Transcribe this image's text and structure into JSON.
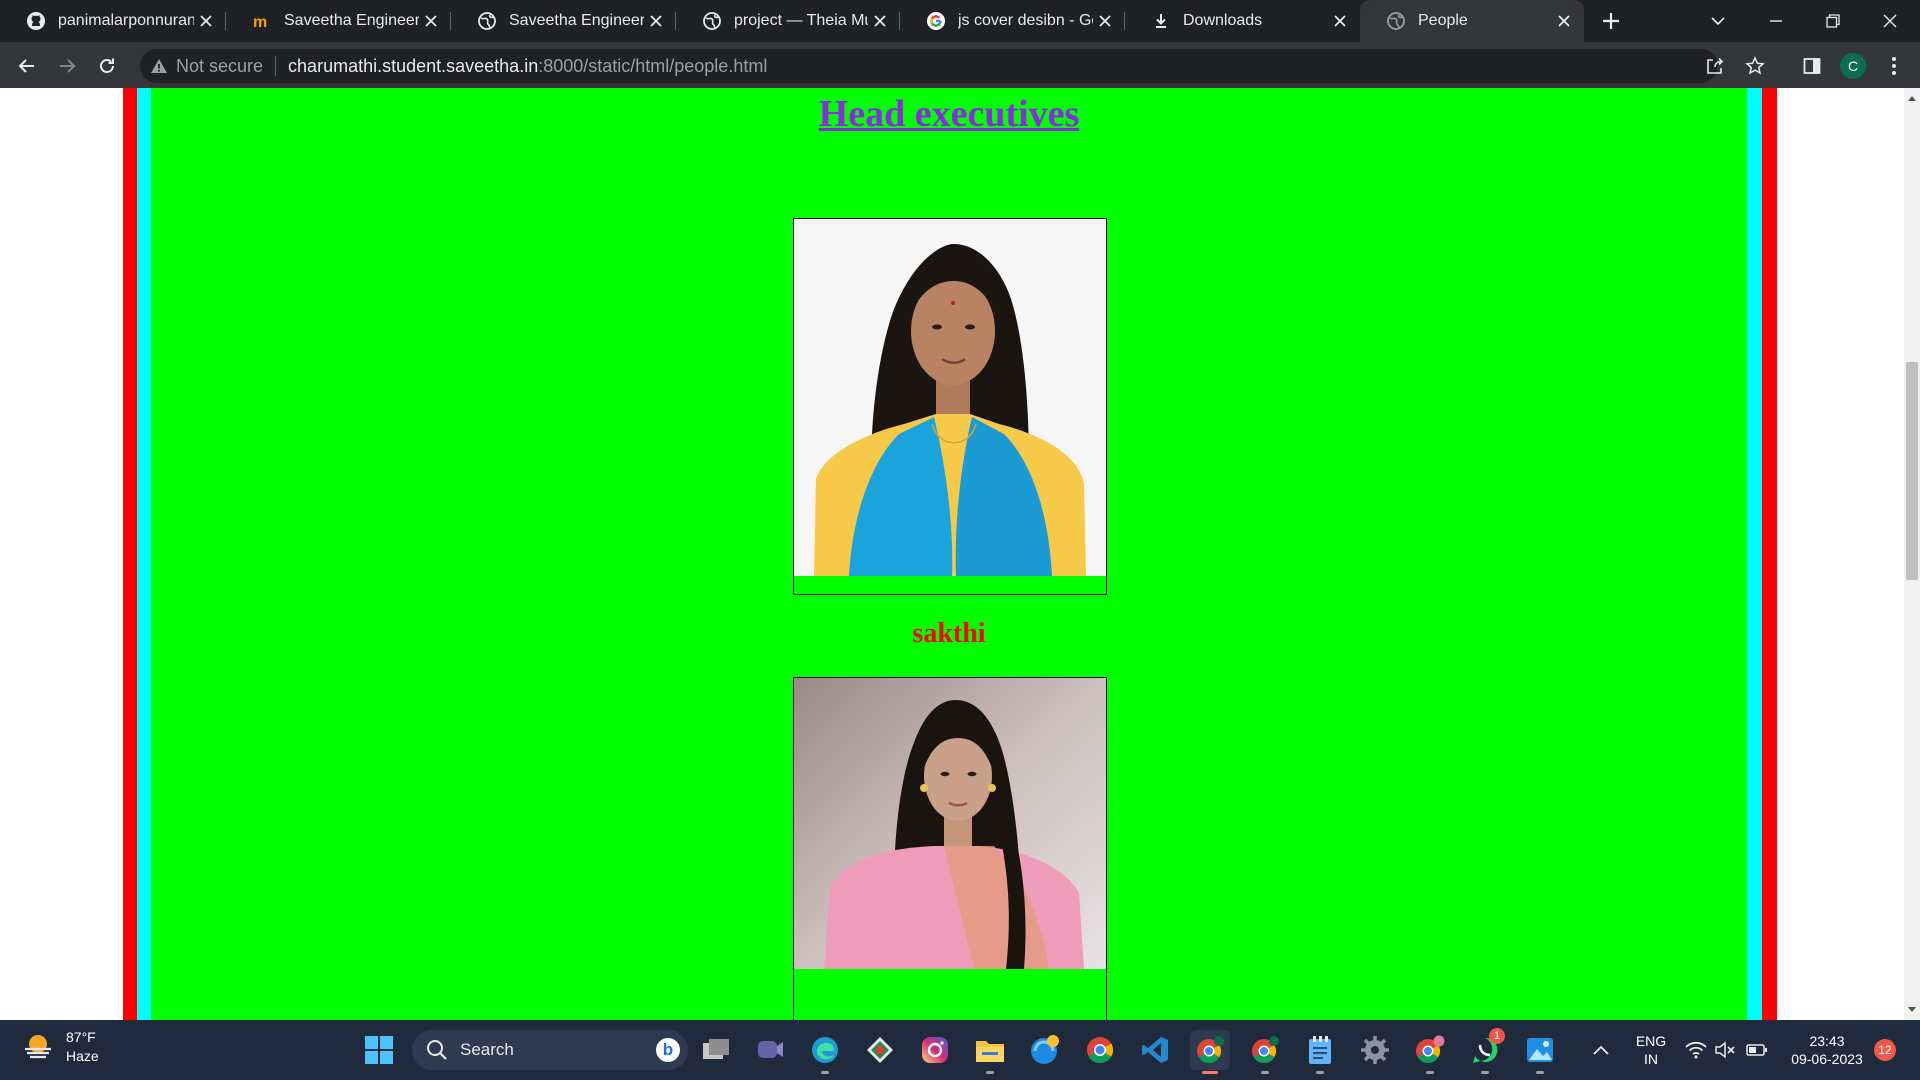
{
  "browser": {
    "tabs": [
      {
        "title": "panimalarponnurangam",
        "icon": "github-icon"
      },
      {
        "title": "Saveetha Engineering",
        "icon": "saveetha-m-icon"
      },
      {
        "title": "Saveetha Engineering",
        "icon": "globe-icon"
      },
      {
        "title": "project — Theia Multi",
        "icon": "globe-icon"
      },
      {
        "title": "js cover desibn - Goo",
        "icon": "google-icon"
      },
      {
        "title": "Downloads",
        "icon": "download-icon"
      },
      {
        "title": "People",
        "icon": "globe-icon",
        "active": true
      }
    ],
    "address": {
      "security_label": "Not secure",
      "url_host": "charumathi.student.saveetha.in",
      "url_path": ":8000/static/html/people.html"
    },
    "profile_initial": "C"
  },
  "page": {
    "heading": "Head executives",
    "people": [
      {
        "name": "sakthi",
        "photo": "portrait-photo"
      },
      {
        "name": "",
        "photo": "portrait-photo"
      }
    ],
    "colors": {
      "background": "#00ff00",
      "outer_border": "#ff0000",
      "inner_border": "#00ffff",
      "heading": "#8a2be2",
      "name": "#ff0000"
    }
  },
  "taskbar": {
    "weather": {
      "temp": "87°F",
      "condition": "Haze"
    },
    "search_placeholder": "Search",
    "language": {
      "line1": "ENG",
      "line2": "IN"
    },
    "clock": {
      "time": "23:43",
      "date": "09-06-2023"
    },
    "notification_count": "12",
    "whatsapp_badge": "1"
  }
}
